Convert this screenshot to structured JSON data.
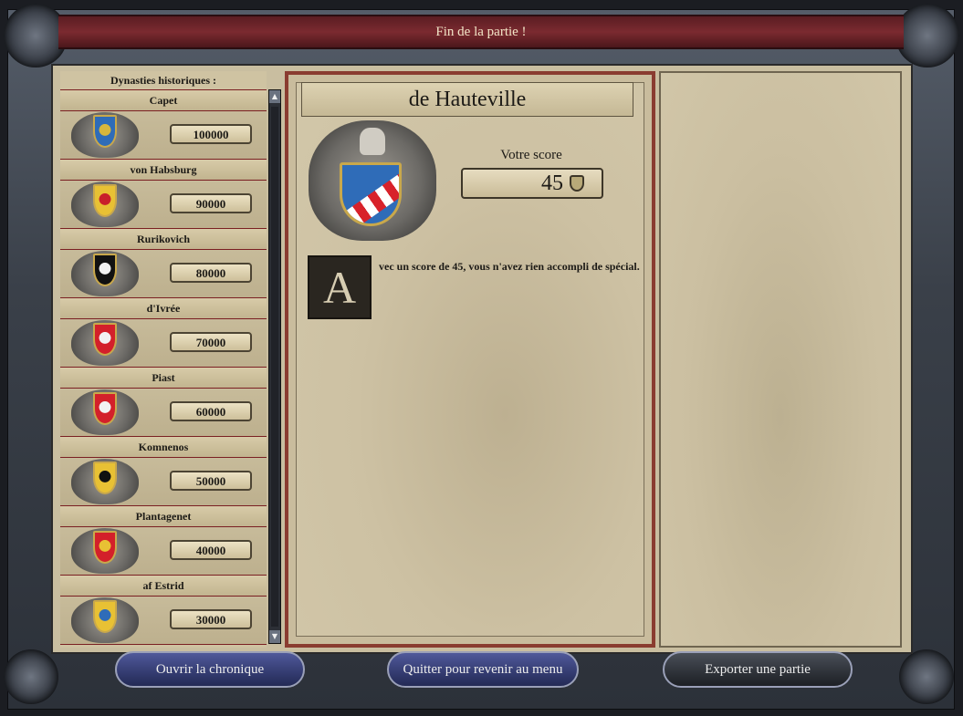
{
  "window": {
    "title": "Fin de la partie !"
  },
  "dynasties": {
    "header": "Dynasties historiques :",
    "items": [
      {
        "name": "Capet",
        "score": "100000",
        "coa_color": "#2f6cb8",
        "coa_charge": "#d7b63c"
      },
      {
        "name": "von Habsburg",
        "score": "90000",
        "coa_color": "#e8c134",
        "coa_charge": "#c8202a"
      },
      {
        "name": "Rurikovich",
        "score": "80000",
        "coa_color": "#111111",
        "coa_charge": "#f2f2f2"
      },
      {
        "name": "d'Ivrée",
        "score": "70000",
        "coa_color": "#d3202a",
        "coa_charge": "#f2f2f2"
      },
      {
        "name": "Piast",
        "score": "60000",
        "coa_color": "#d3202a",
        "coa_charge": "#f2f2f2"
      },
      {
        "name": "Komnenos",
        "score": "50000",
        "coa_color": "#e8c134",
        "coa_charge": "#111111"
      },
      {
        "name": "Plantagenet",
        "score": "40000",
        "coa_color": "#d3202a",
        "coa_charge": "#e8c134"
      },
      {
        "name": "af Estrid",
        "score": "30000",
        "coa_color": "#e8c134",
        "coa_charge": "#2f6cb8"
      }
    ],
    "scroll_up": "▲",
    "scroll_down": "▼"
  },
  "player": {
    "dynasty_name": "de Hauteville",
    "score_label": "Votre score",
    "score_value": "45",
    "dropcap": "A",
    "description": "vec un score de 45, vous n'avez rien accompli de spécial."
  },
  "buttons": {
    "chronicle": "Ouvrir la chronique",
    "quit": "Quitter pour revenir au menu",
    "export": "Exporter une partie"
  },
  "colors": {
    "title_bar": "#7b2a30",
    "parchment": "#cdc1a3",
    "button_blue": "#363e74"
  }
}
